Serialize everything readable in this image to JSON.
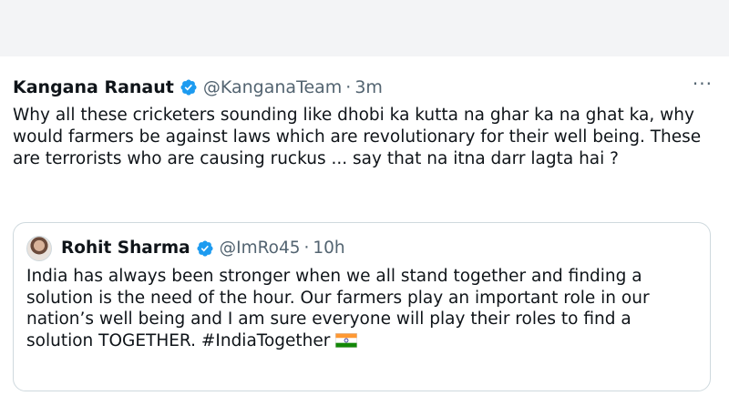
{
  "tweet": {
    "author_name": "Kangana Ranaut",
    "author_handle": "@KanganaTeam",
    "separator": "·",
    "time": "3m",
    "more_label": "···",
    "text": "Why all these cricketers sounding like dhobi ka kutta na ghar ka na ghat ka, why would farmers be against laws which are revolutionary for their well being. These are terrorists who are causing ruckus ... say that na itna darr lagta hai ?"
  },
  "quoted_tweet": {
    "author_name": "Rohit Sharma",
    "author_handle": "@ImRo45",
    "separator": "·",
    "time": "10h",
    "text": "India has always been stronger when we all stand together and finding a solution is the need of the hour. Our farmers play an important role in our nation’s well being and I am sure everyone will play their roles to find a solution TOGETHER. #IndiaTogether"
  },
  "icons": {
    "verified": "verified-badge-icon",
    "more": "more-options-icon",
    "flag": "india-flag-icon",
    "avatar": "avatar"
  },
  "colors": {
    "verified_blue": "#1d9bf0",
    "muted_text": "#536471",
    "border": "#cfd9de"
  }
}
